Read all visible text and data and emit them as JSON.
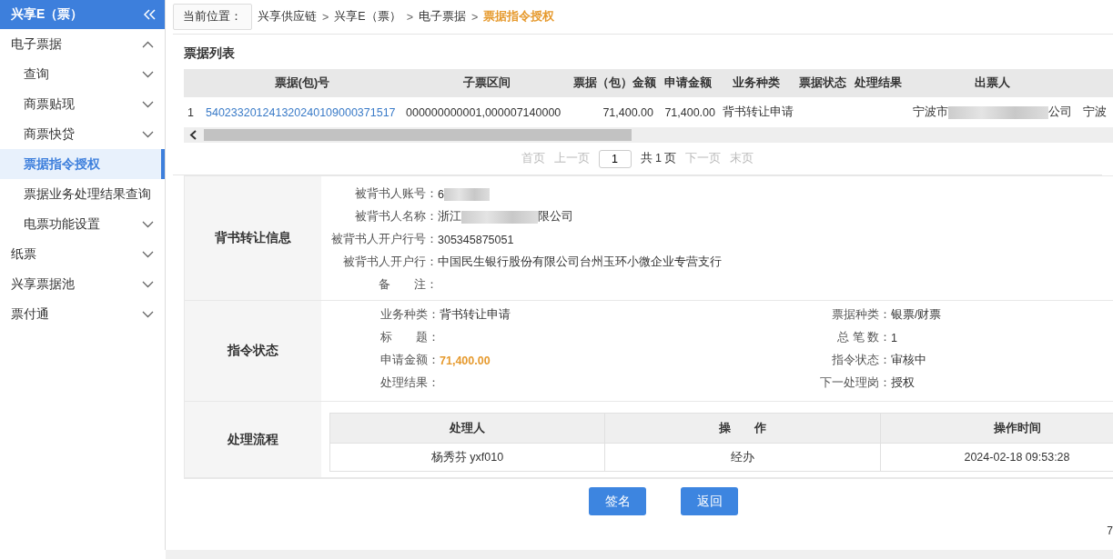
{
  "sidebar": {
    "title": "兴享E（票）",
    "items": [
      {
        "kind": "group",
        "label": "电子票据",
        "expanded": true,
        "children": [
          {
            "kind": "group",
            "label": "查询",
            "expanded": false
          },
          {
            "kind": "group",
            "label": "商票贴现",
            "expanded": false
          },
          {
            "kind": "group",
            "label": "商票快贷",
            "expanded": false
          },
          {
            "kind": "link",
            "label": "票据指令授权",
            "selected": true
          },
          {
            "kind": "link",
            "label": "票据业务处理结果查询",
            "selected": false
          },
          {
            "kind": "group",
            "label": "电票功能设置",
            "expanded": false
          }
        ]
      },
      {
        "kind": "group",
        "label": "纸票",
        "expanded": false
      },
      {
        "kind": "group",
        "label": "兴享票据池",
        "expanded": false
      },
      {
        "kind": "group",
        "label": "票付通",
        "expanded": false
      }
    ]
  },
  "breadcrumb": {
    "label": "当前位置：",
    "separator": ">",
    "items": [
      {
        "text": "兴享供应链",
        "current": false
      },
      {
        "text": "兴享E（票）",
        "current": false
      },
      {
        "text": "电子票据",
        "current": false
      },
      {
        "text": "票据指令授权",
        "current": true
      }
    ]
  },
  "list": {
    "title": "票据列表",
    "columns": [
      "票据(包)号",
      "子票区间",
      "票据（包）金额",
      "申请金额",
      "业务种类",
      "票据状态",
      "处理结果",
      "出票人"
    ],
    "rows": [
      {
        "index": "1",
        "cells": [
          {
            "text": "540233201241320240109000371517",
            "kind": "link"
          },
          {
            "text": "000000000001,000007140000",
            "kind": "text"
          },
          {
            "text": "71,400.00",
            "kind": "num"
          },
          {
            "text": "71,400.00",
            "kind": "num"
          },
          {
            "text": "背书转让申请",
            "kind": "text"
          },
          {
            "kind": "empty"
          },
          {
            "kind": "empty"
          },
          {
            "text": "宁波市",
            "after": "公司",
            "kind": "redacted"
          },
          {
            "text": "宁波",
            "kind": "text"
          }
        ]
      }
    ]
  },
  "pagination": {
    "buttons": [
      {
        "label": "首页",
        "disabled": true
      },
      {
        "label": "上一页",
        "disabled": true
      }
    ],
    "page": "1",
    "total": "共 1 页",
    "next_buttons": [
      {
        "label": "下一页",
        "disabled": true
      },
      {
        "label": "末页",
        "disabled": true
      }
    ]
  },
  "sections": [
    {
      "kind": "fields",
      "title": "背书转让信息",
      "fields": [
        {
          "label": "被背书人账号：",
          "value": "6",
          "redacted": true
        },
        {
          "label": "被背书人名称：",
          "value": "浙江",
          "redacted": true,
          "after": "限公司"
        },
        {
          "label": "被背书人开户行号：",
          "value": "305345875051",
          "redacted": false
        },
        {
          "label": "被背书人开户行：",
          "value": "中国民生银行股份有限公司台州玉环小微企业专营支行",
          "redacted": false
        },
        {
          "label": "备　　注："
        }
      ]
    },
    {
      "kind": "pairs",
      "title": "指令状态",
      "left": [
        {
          "label": "业务种类：",
          "value": "背书转让申请",
          "highlight": false
        },
        {
          "label": "标　　题："
        },
        {
          "label": "申请金额：",
          "value": "71,400.00",
          "highlight": true
        },
        {
          "label": "处理结果："
        }
      ],
      "right": [
        {
          "label": "票据种类：",
          "value": "银票/财票",
          "highlight": false
        },
        {
          "label": "总 笔 数：",
          "value": "1",
          "highlight": false
        },
        {
          "label": "指令状态：",
          "value": "审核中",
          "highlight": false
        },
        {
          "label": "下一处理岗：",
          "value": "授权",
          "highlight": false
        }
      ]
    },
    {
      "kind": "table",
      "title": "处理流程",
      "columns": [
        "处理人",
        "操　　作",
        "操作时间"
      ],
      "rows": [
        [
          "杨秀芬 yxf010",
          "经办",
          "2024-02-18 09:53:28"
        ]
      ]
    }
  ],
  "actions": [
    "签名",
    "返回"
  ],
  "corner_text": "7"
}
